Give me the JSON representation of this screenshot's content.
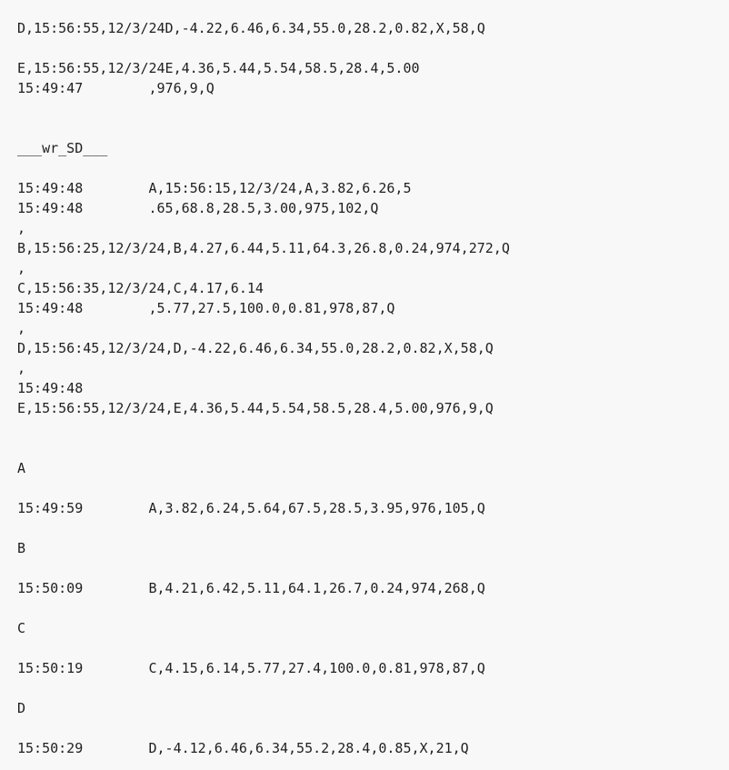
{
  "log": {
    "lines": [
      "D,15:56:55,12/3/24D,-4.22,6.46,6.34,55.0,28.2,0.82,X,58,Q",
      "E,15:56:55,12/3/24E,4.36,5.44,5.54,58.5,28.4,5.00",
      "15:49:47        ,976,9,Q",
      "___wr_SD___",
      "15:49:48        A,15:56:15,12/3/24,A,3.82,6.26,5",
      "15:49:48        .65,68.8,28.5,3.00,975,102,Q",
      ",",
      "B,15:56:25,12/3/24,B,4.27,6.44,5.11,64.3,26.8,0.24,974,272,Q",
      ",",
      "C,15:56:35,12/3/24,C,4.17,6.14",
      "15:49:48        ,5.77,27.5,100.0,0.81,978,87,Q",
      ",",
      "D,15:56:45,12/3/24,D,-4.22,6.46,6.34,55.0,28.2,0.82,X,58,Q",
      ",",
      "15:49:48",
      "E,15:56:55,12/3/24,E,4.36,5.44,5.54,58.5,28.4,5.00,976,9,Q",
      "A",
      "15:49:59        A,3.82,6.24,5.64,67.5,28.5,3.95,976,105,Q",
      "B",
      "15:50:09        B,4.21,6.42,5.11,64.1,26.7,0.24,974,268,Q",
      "C",
      "15:50:19        C,4.15,6.14,5.77,27.4,100.0,0.81,978,87,Q",
      "D",
      "15:50:29        D,-4.12,6.46,6.34,55.2,28.4,0.85,X,21,Q"
    ]
  }
}
